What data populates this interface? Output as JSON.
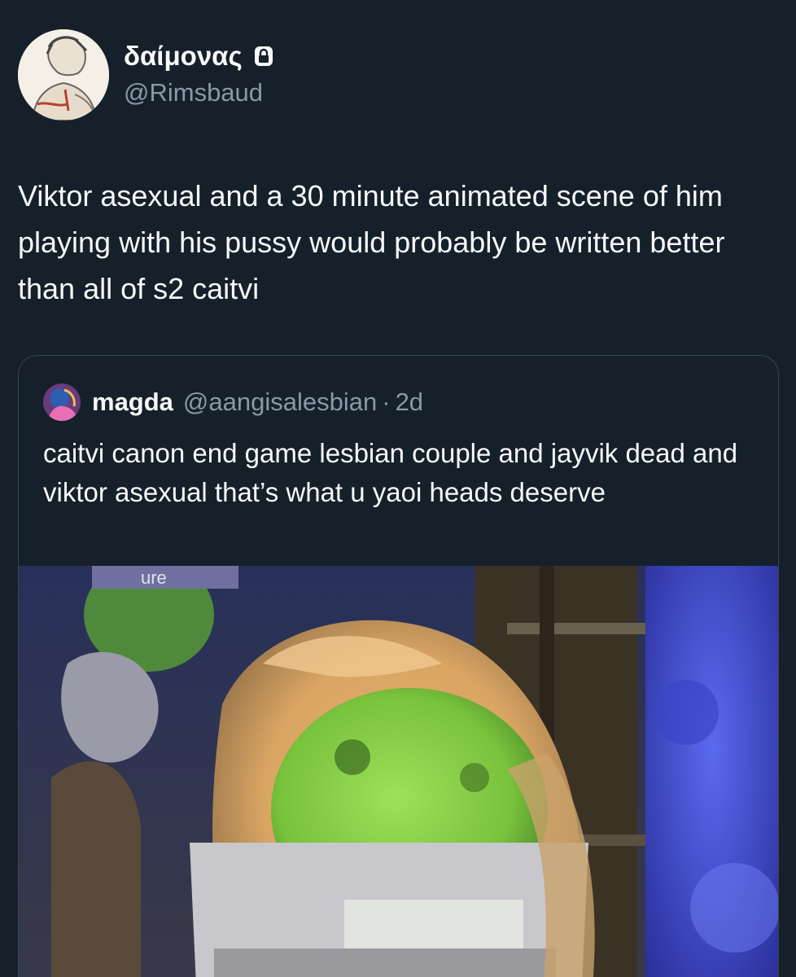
{
  "author": {
    "display_name": "δαίμονας",
    "handle": "@Rimsbaud",
    "avatar_icon": "sketch-portrait-avatar",
    "lock_icon": "lock-icon"
  },
  "tweet": {
    "text": "Viktor asexual and a 30 minute animated scene of him playing with his pussy would probably be written better than all of s2 caitvi"
  },
  "quoted": {
    "display_name": "magda",
    "handle": "@aangisalesbian",
    "separator": "·",
    "time": "2d",
    "text": "caitvi canon end game lesbian couple and jayvik dead and viktor asexual that’s what u yaoi heads deserve",
    "media_text": "ure"
  },
  "colors": {
    "background": "#15202b",
    "text_primary": "#f7f9f9",
    "text_secondary": "#8b98a5",
    "border": "#38444d"
  }
}
